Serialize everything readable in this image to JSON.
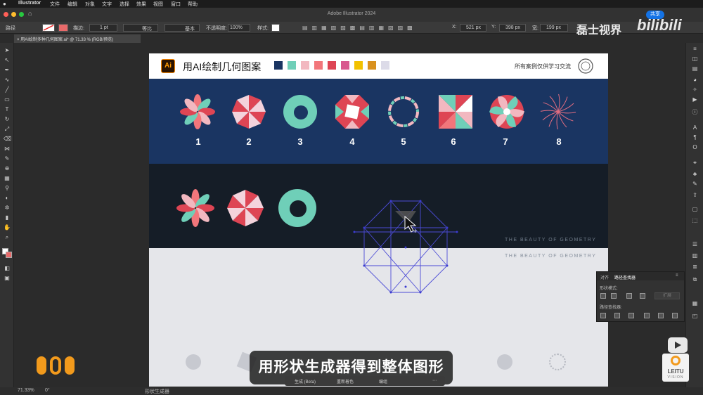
{
  "menubar": {
    "items": [
      "Illustrator",
      "文件",
      "编辑",
      "对象",
      "文字",
      "选择",
      "效果",
      "视图",
      "窗口",
      "帮助"
    ]
  },
  "window": {
    "title": "Adobe Illustrator 2024",
    "share_label": "共享"
  },
  "control_bar": {
    "object_type": "路径",
    "stroke_label": "描边:",
    "stroke_value": "1 pt",
    "profile_label": "等比",
    "brush_label": "基本",
    "opacity_label": "不透明度:",
    "opacity_value": "100%",
    "style_label": "样式:",
    "x_label": "X:",
    "x_value": "521 px",
    "y_label": "Y:",
    "y_value": "398 px",
    "w_label": "宽:",
    "w_value": "199 px"
  },
  "document_tab": {
    "label": "用AI绘制多种几何图案.ai* @ 71.33 % (RGB/预览)"
  },
  "watermark": {
    "channel": "磊士视界",
    "platform": "bilibili"
  },
  "artboard": {
    "title": "用AI绘制几何图案",
    "logo_text": "Ai",
    "notice": "所有案例仅供学习交流",
    "swatches": [
      "#1a3562",
      "#6fcfb8",
      "#f2b8c0",
      "#f2767b",
      "#de4554",
      "#d8578e",
      "#f2c100",
      "#d9911e",
      "#dcdbe8"
    ],
    "pattern_numbers": [
      "1",
      "2",
      "3",
      "4",
      "5",
      "6",
      "7",
      "8"
    ],
    "tagline_1": "THE BEAUTY OF GEOMETRY",
    "tagline_2": "THE BEAUTY OF GEOMETRY"
  },
  "subtitle": "用形状生成器得到整体图形",
  "pathfinder_panel": {
    "tab_align": "对齐",
    "tab_pathfinder": "路径查找器",
    "shape_modes_label": "形状模式:",
    "expand_label": "扩展",
    "pathfinders_label": "路径查找器:"
  },
  "context_bar": {
    "generate": "生成 (Beta)",
    "recolor": "重新着色",
    "group": "编组"
  },
  "status_bar": {
    "zoom": "71.33%",
    "rotation": "0°",
    "tool": "形状生成器"
  },
  "brand": {
    "leitu": "LEITU",
    "vision": "VISION"
  },
  "colors": {
    "accent": "#1a3562",
    "mint": "#6fcfb8",
    "coral": "#f2767b",
    "red": "#de4554",
    "pink": "#f2b8c0"
  }
}
